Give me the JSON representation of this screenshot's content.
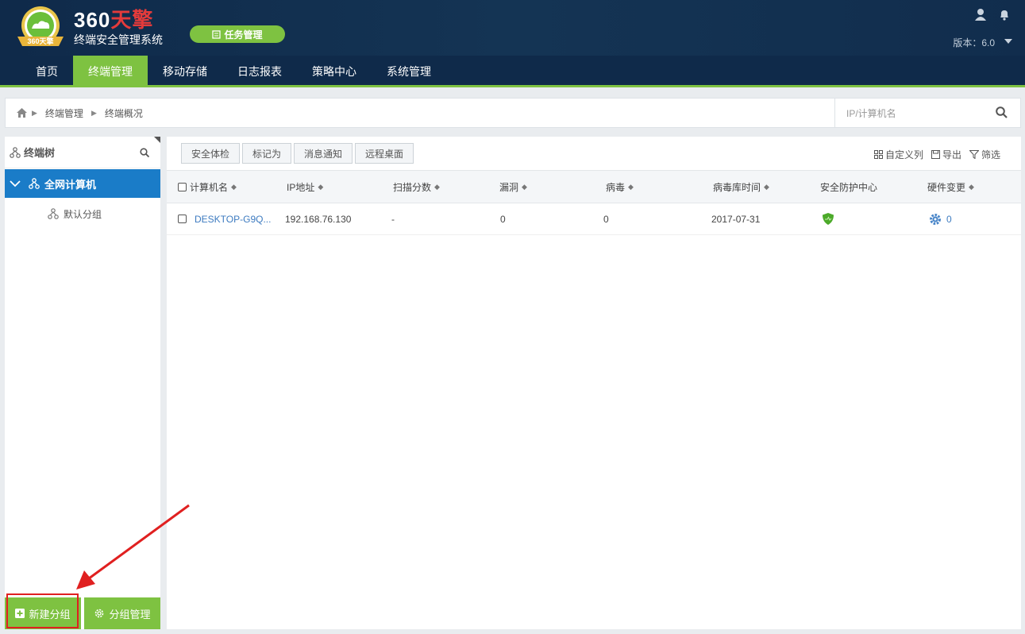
{
  "header": {
    "brand_prefix": "360",
    "brand_suffix": "天擎",
    "subtitle": "终端安全管理系统",
    "badge_text": "360天擎",
    "task_button": "任务管理",
    "version": "版本：6.0"
  },
  "nav": {
    "items": [
      "首页",
      "终端管理",
      "移动存储",
      "日志报表",
      "策略中心",
      "系统管理"
    ],
    "active_index": 1
  },
  "breadcrumb": {
    "items": [
      "终端管理",
      "终端概况"
    ],
    "search_placeholder": "IP/计算机名"
  },
  "tree": {
    "title": "终端树",
    "root": "全网计算机",
    "children": [
      "默认分组"
    ],
    "new_group": "新建分组",
    "manage_group": "分组管理"
  },
  "toolbar": {
    "buttons": [
      "安全体检",
      "标记为",
      "消息通知",
      "远程桌面"
    ],
    "customize": "自定义列",
    "export": "导出",
    "filter": "筛选"
  },
  "table": {
    "columns": [
      "计算机名",
      "IP地址",
      "扫描分数",
      "漏洞",
      "病毒",
      "病毒库时间",
      "安全防护中心",
      "硬件变更"
    ],
    "rows": [
      {
        "name": "DESKTOP-G9Q...",
        "ip": "192.168.76.130",
        "score": "-",
        "vuln": "0",
        "virus": "0",
        "db_time": "2017-07-31",
        "protection": "shield-ok",
        "hardware": "0"
      }
    ]
  },
  "colors": {
    "header_bg": "#0f2a4a",
    "accent_green": "#7ec241",
    "tree_active": "#1a7cc8",
    "link_blue": "#3d7bc0",
    "annotation_red": "#e02020"
  }
}
